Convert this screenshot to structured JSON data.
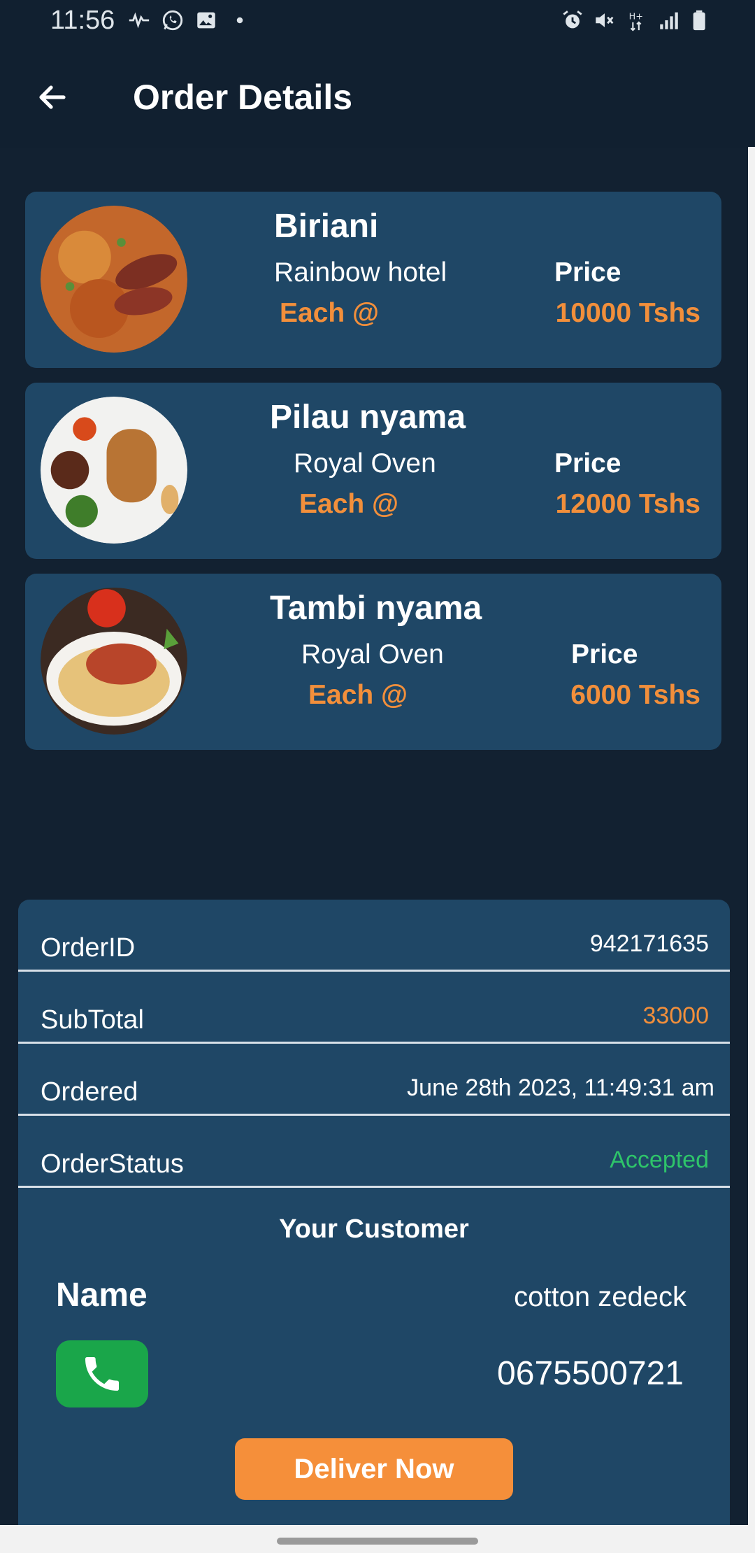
{
  "status_bar": {
    "time": "11:56",
    "left_icons": [
      "activity-icon",
      "whatsapp-icon",
      "image-icon",
      "dot-icon"
    ],
    "right_icons": [
      "alarm-icon",
      "mute-icon",
      "network-h-plus-icon",
      "signal-icon",
      "battery-icon"
    ]
  },
  "header": {
    "title": "Order Details",
    "back_icon": "arrow-left-icon"
  },
  "items": [
    {
      "name": "Biriani",
      "hotel": "Rainbow hotel",
      "each_label": "Each @",
      "price_label": "Price",
      "price_value": "10000 Tshs"
    },
    {
      "name": "Pilau nyama",
      "hotel": "Royal Oven",
      "each_label": "Each @",
      "price_label": "Price",
      "price_value": "12000 Tshs"
    },
    {
      "name": "Tambi nyama",
      "hotel": "Royal Oven",
      "each_label": "Each @",
      "price_label": "Price",
      "price_value": "6000 Tshs"
    }
  ],
  "summary": {
    "order_id_label": "OrderID",
    "order_id_value": "942171635",
    "subtotal_label": "SubTotal",
    "subtotal_value": "33000",
    "ordered_label": "Ordered",
    "ordered_value": "June 28th 2023, 11:49:31 am",
    "status_label": "OrderStatus",
    "status_value": "Accepted"
  },
  "customer": {
    "title": "Your Customer",
    "name_label": "Name",
    "name_value": "cotton zedeck",
    "phone": "0675500721",
    "call_icon": "phone-icon"
  },
  "actions": {
    "deliver_label": "Deliver Now"
  },
  "colors": {
    "background": "#122131",
    "card": "#1f4766",
    "accent_orange": "#f28f3b",
    "status_green": "#2ec46a",
    "call_green": "#1aa64a"
  }
}
